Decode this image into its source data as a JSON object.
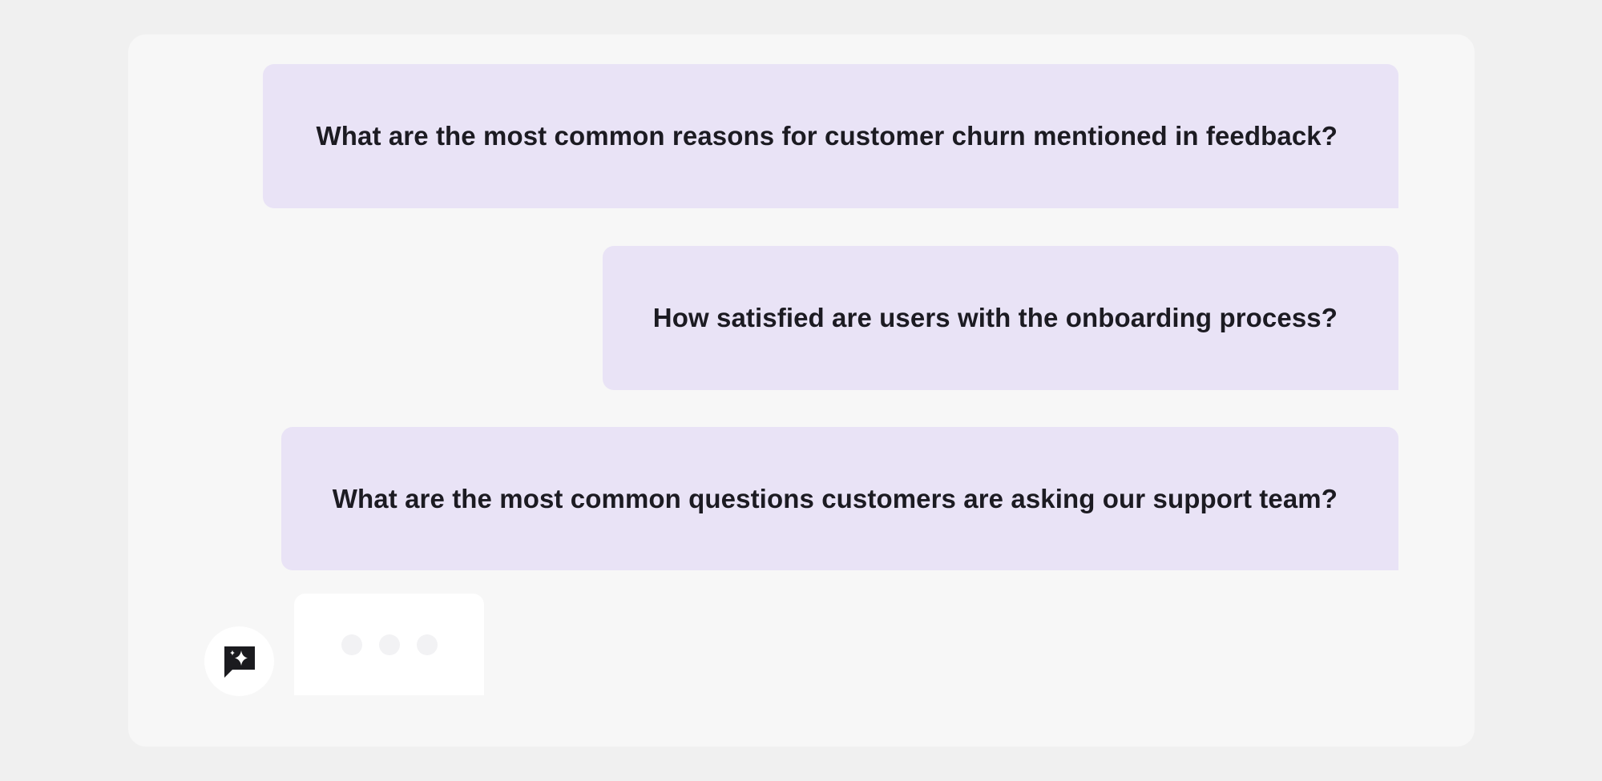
{
  "chat": {
    "messages": [
      {
        "role": "user",
        "text": "What are the most common reasons for customer churn mentioned in feedback?"
      },
      {
        "role": "user",
        "text": "How satisfied are users with the onboarding process?"
      },
      {
        "role": "user",
        "text": "What are the most common questions customers are asking our support team?"
      }
    ],
    "assistant": {
      "icon": "sparkle-chat-icon",
      "state": "typing"
    }
  },
  "colors": {
    "page_background": "#f0f0f0",
    "panel_background": "#f7f7f7",
    "user_bubble": "#e9e3f6",
    "text": "#1c1b22",
    "assistant_bubble": "#ffffff"
  }
}
